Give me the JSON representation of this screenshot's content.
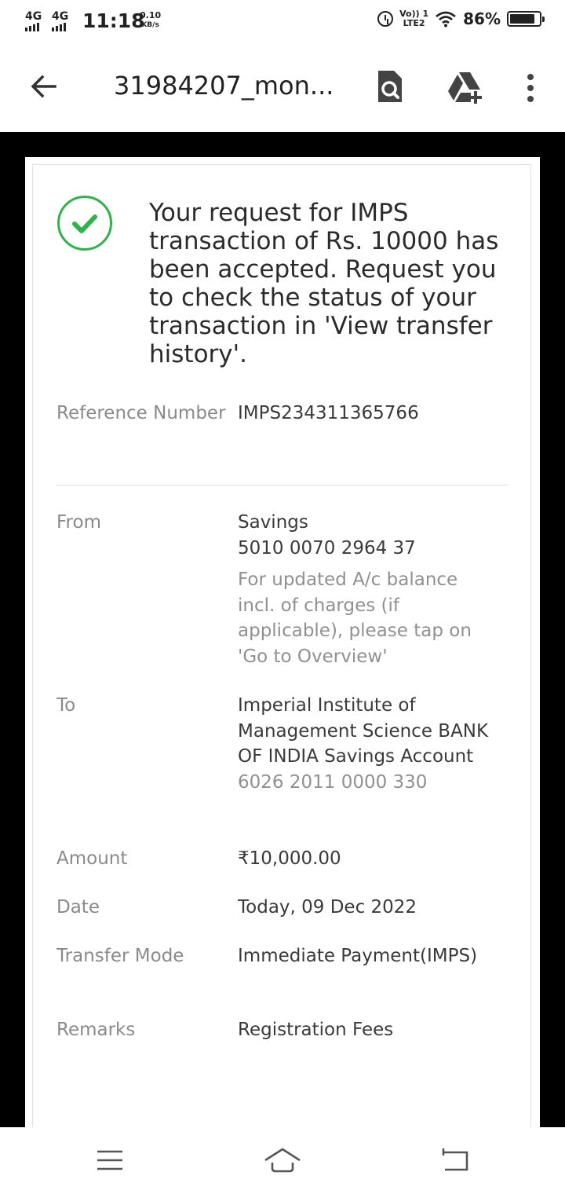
{
  "status_bar": {
    "network_1": "4G",
    "network_2": "4G",
    "time": "11:18",
    "speed_value": "0.10",
    "speed_unit": "KB/s",
    "volte_line1": "Vo)) 1",
    "volte_line2": "LTE2",
    "battery": "86%"
  },
  "app_bar": {
    "title": "31984207_mon...",
    "icons": [
      "back-arrow-icon",
      "document-search-icon",
      "drive-add-icon",
      "more-vertical-icon"
    ]
  },
  "confirmation": {
    "icon": "check-circle-icon",
    "accent_color": "#2fb24a",
    "message": "Your request for IMPS transaction of Rs. 10000 has been accepted. Request you to check the status of your transaction in 'View transfer history'."
  },
  "details": {
    "reference": {
      "label": "Reference Number",
      "value": "IMPS234311365766"
    },
    "from": {
      "label": "From",
      "account_type": "Savings",
      "account_number": "5010 0070 2964 37",
      "note": "For updated A/c balance incl. of charges (if applicable), please tap on 'Go to Overview'"
    },
    "to": {
      "label": "To",
      "payee": "Imperial Institute of Management Science BANK OF INDIA Savings Account",
      "account_number": "6026 2011 0000 330"
    },
    "amount": {
      "label": "Amount",
      "value": "₹10,000.00"
    },
    "date": {
      "label": "Date",
      "value": "Today, 09 Dec 2022"
    },
    "transfer_mode": {
      "label": "Transfer Mode",
      "value": "Immediate Payment(IMPS)"
    },
    "remarks": {
      "label": "Remarks",
      "value": "Registration Fees"
    }
  },
  "nav_bar": {
    "icons": [
      "menu-icon",
      "home-icon",
      "back-icon"
    ]
  }
}
